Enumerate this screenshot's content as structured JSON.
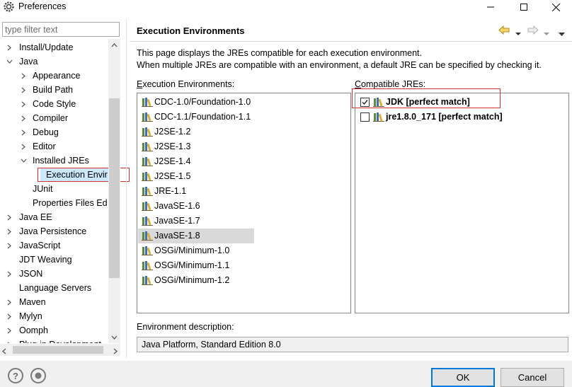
{
  "window": {
    "title": "Preferences",
    "controls": [
      "minimize",
      "maximize",
      "close"
    ]
  },
  "filter": {
    "placeholder": "type filter text"
  },
  "tree": [
    {
      "label": "Install/Update",
      "expanded": false
    },
    {
      "label": "Java",
      "expanded": true
    },
    {
      "label": "Appearance",
      "expanded": false
    },
    {
      "label": "Build Path",
      "expanded": false
    },
    {
      "label": "Code Style",
      "expanded": false
    },
    {
      "label": "Compiler",
      "expanded": false
    },
    {
      "label": "Debug",
      "expanded": false
    },
    {
      "label": "Editor",
      "expanded": false
    },
    {
      "label": "Installed JREs",
      "expanded": true
    },
    {
      "label": "Execution Envir",
      "selected": true
    },
    {
      "label": "JUnit"
    },
    {
      "label": "Properties Files Ed",
      "expanded": false
    },
    {
      "label": "Java EE",
      "expanded": false
    },
    {
      "label": "Java Persistence",
      "expanded": false
    },
    {
      "label": "JavaScript",
      "expanded": false
    },
    {
      "label": "JDT Weaving"
    },
    {
      "label": "JSON",
      "expanded": false
    },
    {
      "label": "Language Servers"
    },
    {
      "label": "Maven",
      "expanded": false
    },
    {
      "label": "Mylyn",
      "expanded": false
    },
    {
      "label": "Oomph",
      "expanded": false
    },
    {
      "label": "Plug-in Development",
      "expanded": false
    }
  ],
  "page": {
    "title": "Execution Environments",
    "description_line1": "This page displays the JREs compatible for each execution environment.",
    "description_line2": "When multiple JREs are compatible with an environment, a default JRE can be specified by checking it.",
    "env_label_mnemonic": "E",
    "env_label_rest": "xecution Environments:",
    "compat_label_mnemonic": "C",
    "compat_label_rest": "ompatible JREs:",
    "env_desc_label": "Environment description:",
    "env_desc_value": "Java Platform, Standard Edition 8.0"
  },
  "environments": [
    {
      "label": "CDC-1.0/Foundation-1.0"
    },
    {
      "label": "CDC-1.1/Foundation-1.1"
    },
    {
      "label": "J2SE-1.2"
    },
    {
      "label": "J2SE-1.3"
    },
    {
      "label": "J2SE-1.4"
    },
    {
      "label": "J2SE-1.5"
    },
    {
      "label": "JRE-1.1"
    },
    {
      "label": "JavaSE-1.6"
    },
    {
      "label": "JavaSE-1.7"
    },
    {
      "label": "JavaSE-1.8",
      "selected": true
    },
    {
      "label": "OSGi/Minimum-1.0"
    },
    {
      "label": "OSGi/Minimum-1.1"
    },
    {
      "label": "OSGi/Minimum-1.2"
    }
  ],
  "compatible_jres": [
    {
      "label": "JDK [perfect match]",
      "checked": true
    },
    {
      "label": "jre1.8.0_171 [perfect match]",
      "checked": false
    }
  ],
  "buttons": {
    "ok": "OK",
    "cancel": "Cancel",
    "help": "?"
  },
  "colors": {
    "highlight_box": "#d63232",
    "default_button_border": "#0078d7",
    "selection_bg": "#d9d9d9"
  }
}
